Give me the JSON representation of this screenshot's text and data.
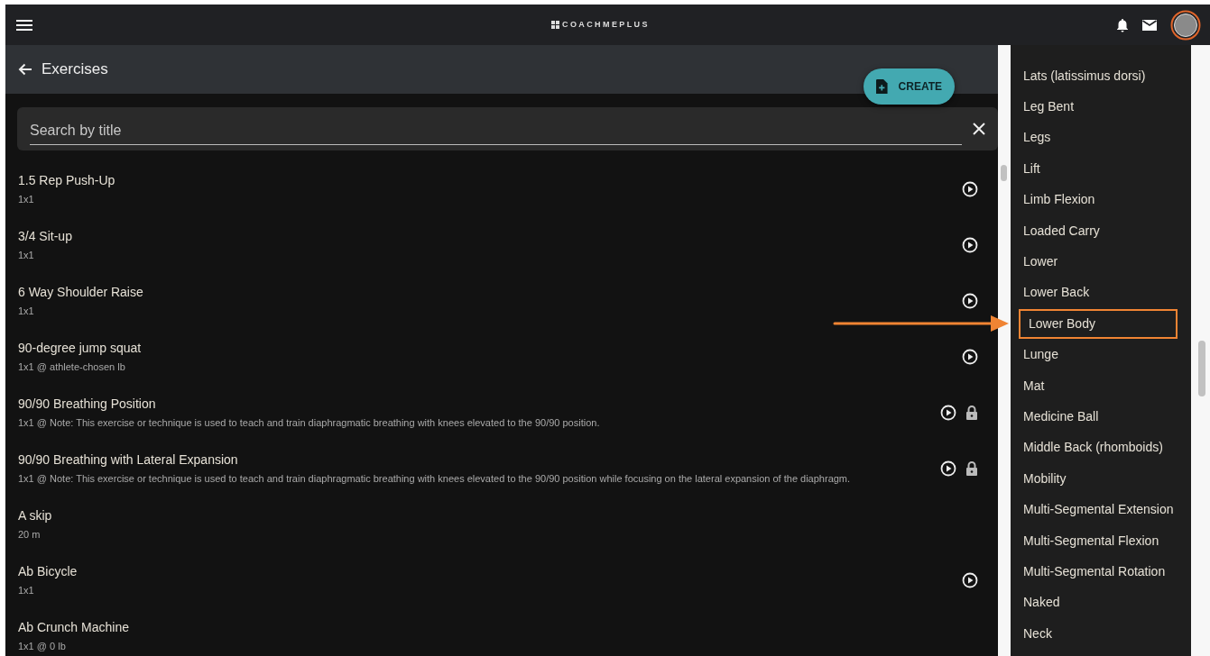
{
  "app_bar": {
    "logo_text": "COACHMEPLUS"
  },
  "page": {
    "title": "Exercises"
  },
  "create_button": {
    "label": "CREATE"
  },
  "search": {
    "placeholder": "Search by title"
  },
  "exercises": [
    {
      "title": "1.5 Rep Push-Up",
      "detail": "1x1",
      "video": true,
      "locked": false
    },
    {
      "title": "3/4 Sit-up",
      "detail": "1x1",
      "video": true,
      "locked": false
    },
    {
      "title": "6 Way Shoulder Raise",
      "detail": "1x1",
      "video": true,
      "locked": false
    },
    {
      "title": "90-degree jump squat",
      "detail": "1x1 @ athlete-chosen lb",
      "video": true,
      "locked": false
    },
    {
      "title": "90/90 Breathing Position",
      "detail": "1x1 @ Note: This exercise or technique is used to teach and train diaphragmatic breathing with knees elevated to the 90/90 position.",
      "video": true,
      "locked": true
    },
    {
      "title": "90/90 Breathing with Lateral Expansion",
      "detail": "1x1 @ Note: This exercise or technique is used to teach and train diaphragmatic breathing with knees elevated to the 90/90 position while focusing on the lateral expansion of the diaphragm.",
      "video": true,
      "locked": true
    },
    {
      "title": "A skip",
      "detail": "20 m",
      "video": false,
      "locked": false
    },
    {
      "title": "Ab Bicycle",
      "detail": "1x1",
      "video": true,
      "locked": false
    },
    {
      "title": "Ab Crunch Machine",
      "detail": "1x1 @ 0 lb",
      "video": false,
      "locked": false
    }
  ],
  "tag_menu": [
    {
      "label": "Lats (latissimus dorsi)",
      "highlighted": false
    },
    {
      "label": "Leg Bent",
      "highlighted": false
    },
    {
      "label": "Legs",
      "highlighted": false
    },
    {
      "label": "Lift",
      "highlighted": false
    },
    {
      "label": "Limb Flexion",
      "highlighted": false
    },
    {
      "label": "Loaded Carry",
      "highlighted": false
    },
    {
      "label": "Lower",
      "highlighted": false
    },
    {
      "label": "Lower Back",
      "highlighted": false
    },
    {
      "label": "Lower Body",
      "highlighted": true
    },
    {
      "label": "Lunge",
      "highlighted": false
    },
    {
      "label": "Mat",
      "highlighted": false
    },
    {
      "label": "Medicine Ball",
      "highlighted": false
    },
    {
      "label": "Middle Back (rhomboids)",
      "highlighted": false
    },
    {
      "label": "Mobility",
      "highlighted": false
    },
    {
      "label": "Multi-Segmental Extension",
      "highlighted": false
    },
    {
      "label": "Multi-Segmental Flexion",
      "highlighted": false
    },
    {
      "label": "Multi-Segmental Rotation",
      "highlighted": false
    },
    {
      "label": "Naked",
      "highlighted": false
    },
    {
      "label": "Neck",
      "highlighted": false
    }
  ]
}
